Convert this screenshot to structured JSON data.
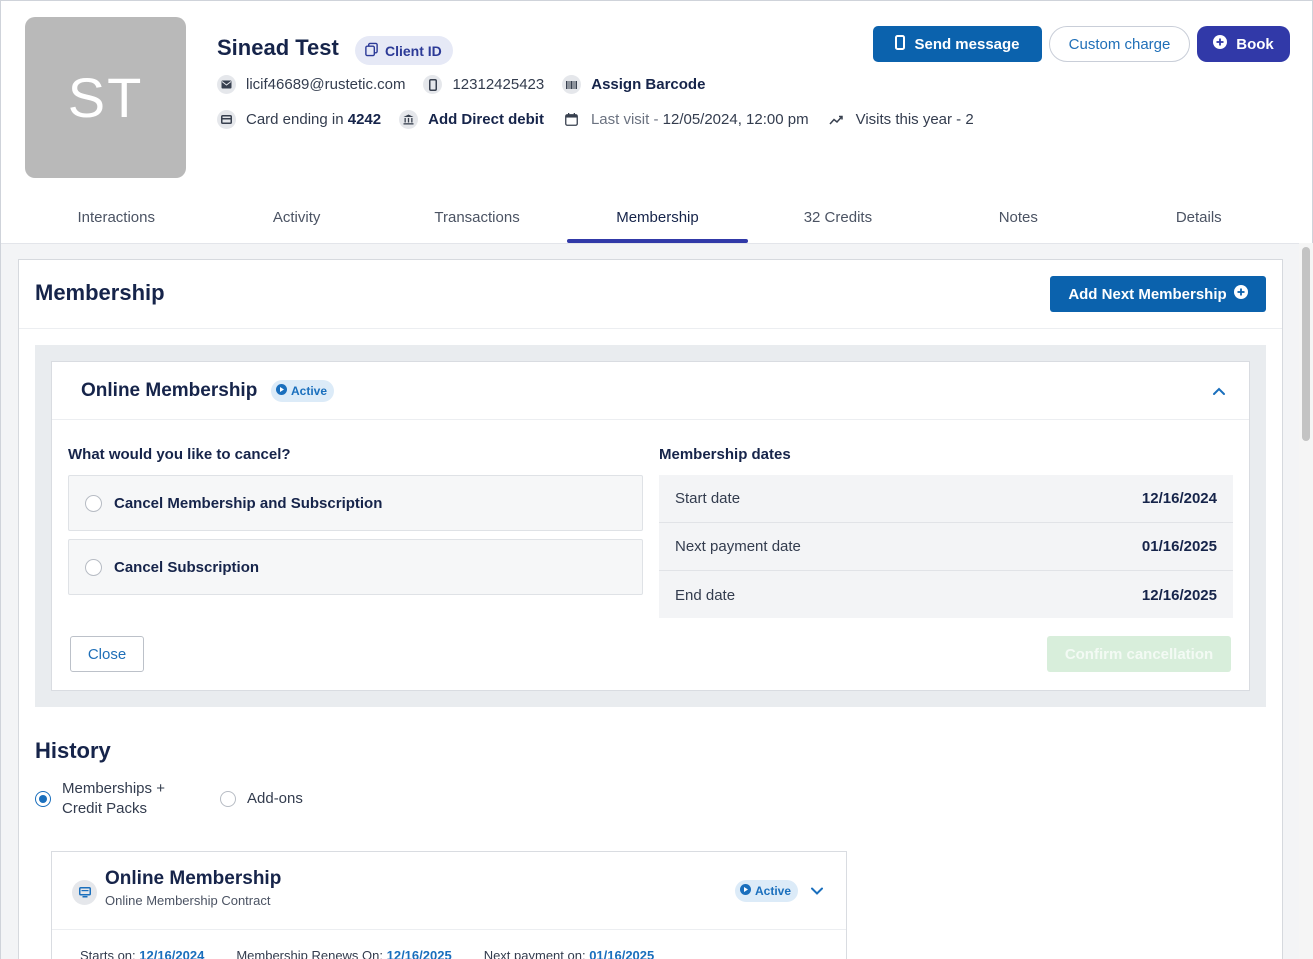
{
  "client": {
    "initials": "ST",
    "name": "Sinead Test",
    "client_id_label": "Client ID",
    "email": "licif46689@rustetic.com",
    "phone": "12312425423",
    "assign_barcode": "Assign Barcode",
    "card_prefix": "Card ending in ",
    "card_last4": "4242",
    "add_direct_debit": "Add Direct debit",
    "last_visit_label": "Last visit - ",
    "last_visit_value": "12/05/2024, 12:00 pm",
    "visits_this_year": "Visits this year - 2"
  },
  "actions": {
    "send_message": "Send message",
    "custom_charge": "Custom charge",
    "book": "Book"
  },
  "tabs": [
    {
      "label": "Interactions"
    },
    {
      "label": "Activity"
    },
    {
      "label": "Transactions"
    },
    {
      "label": "Membership",
      "active": true
    },
    {
      "label": "32 Credits"
    },
    {
      "label": "Notes"
    },
    {
      "label": "Details"
    }
  ],
  "membership": {
    "title": "Membership",
    "add_next_label": "Add Next Membership",
    "card": {
      "title": "Online Membership",
      "status": "Active",
      "question": "What would you like to cancel?",
      "options": [
        {
          "label": "Cancel Membership and Subscription"
        },
        {
          "label": "Cancel Subscription"
        }
      ],
      "dates_title": "Membership dates",
      "dates": [
        {
          "label": "Start date",
          "value": "12/16/2024"
        },
        {
          "label": "Next payment date",
          "value": "01/16/2025"
        },
        {
          "label": "End date",
          "value": "12/16/2025"
        }
      ],
      "close_label": "Close",
      "confirm_label": "Confirm cancellation"
    }
  },
  "history": {
    "title": "History",
    "filter_memberships_line1": "Memberships +",
    "filter_memberships_line2": "Credit Packs",
    "filter_addons": "Add-ons",
    "item": {
      "name": "Online Membership",
      "subtitle": "Online Membership Contract",
      "status": "Active",
      "starts_label": "Starts on: ",
      "starts_value": "12/16/2024",
      "renews_label": "Membership Renews On: ",
      "renews_value": "12/16/2025",
      "next_payment_label": "Next payment on: ",
      "next_payment_value": "01/16/2025"
    }
  },
  "colors": {
    "primary_blue": "#0b62ad",
    "indigo": "#3139a8",
    "active_badge_bg": "#dcebf8",
    "confirm_disabled": "#d8eedb"
  }
}
